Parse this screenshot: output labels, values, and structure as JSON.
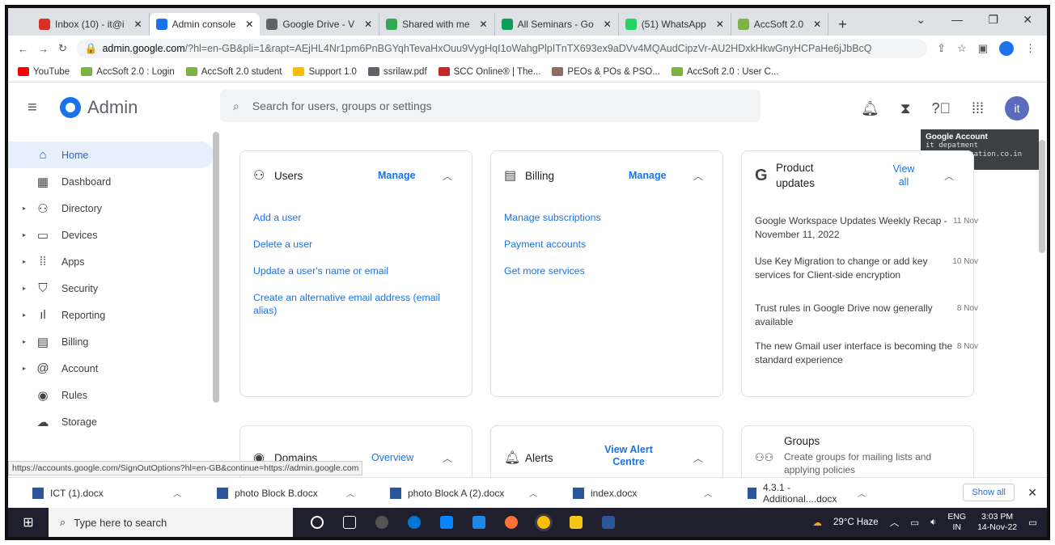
{
  "browser": {
    "tabs": [
      {
        "label": "Inbox (10) - it@i",
        "color": "#d93025"
      },
      {
        "label": "Admin console",
        "color": "#1a73e8"
      },
      {
        "label": "Google Drive - V",
        "color": "#5f6368"
      },
      {
        "label": "Shared with me",
        "color": "#34a853"
      },
      {
        "label": "All Seminars - Go",
        "color": "#0f9d58"
      },
      {
        "label": "(51) WhatsApp",
        "color": "#25d366"
      },
      {
        "label": "AccSoft 2.0",
        "color": "#7cb342"
      }
    ],
    "url_host": "admin.google.com",
    "url_rest": "/?hl=en-GB&pli=1&rapt=AEjHL4Nr1pm6PnBGYqhTevaHxOuu9VygHqI1oWahgPlpITnTX693ex9aDVv4MQAudCipzVr-AU2HDxkHkwGnyHCPaHe6jJbBcQ",
    "bookmarks": [
      {
        "label": "YouTube",
        "color": "#ff0000"
      },
      {
        "label": "AccSoft 2.0 : Login",
        "color": "#7cb342"
      },
      {
        "label": "AccSoft 2.0 student",
        "color": "#7cb342"
      },
      {
        "label": "Support 1.0",
        "color": "#fbbc04"
      },
      {
        "label": "ssrilaw.pdf",
        "color": "#5f6368"
      },
      {
        "label": "SCC Online® | The...",
        "color": "#c62828"
      },
      {
        "label": "PEOs & POs & PSO...",
        "color": "#8d6e63"
      },
      {
        "label": "AccSoft 2.0 : User C...",
        "color": "#7cb342"
      }
    ]
  },
  "header": {
    "app_name": "Admin",
    "search_placeholder": "Search for users, groups or settings",
    "avatar_letter": "it"
  },
  "tooltip": {
    "title": "Google Account",
    "name": "it depatment",
    "email": "it@iconeducation.co.in"
  },
  "sidebar": {
    "items": [
      {
        "label": "Home",
        "icon": "⌂",
        "caret": ""
      },
      {
        "label": "Dashboard",
        "icon": "▦",
        "caret": ""
      },
      {
        "label": "Directory",
        "icon": "⚇",
        "caret": "▸"
      },
      {
        "label": "Devices",
        "icon": "▭",
        "caret": "▸"
      },
      {
        "label": "Apps",
        "icon": "⁞⁞",
        "caret": "▸"
      },
      {
        "label": "Security",
        "icon": "⛉",
        "caret": "▸"
      },
      {
        "label": "Reporting",
        "icon": "ıl",
        "caret": "▸"
      },
      {
        "label": "Billing",
        "icon": "▤",
        "caret": "▸"
      },
      {
        "label": "Account",
        "icon": "@",
        "caret": "▸"
      },
      {
        "label": "Rules",
        "icon": "◉",
        "caret": ""
      },
      {
        "label": "Storage",
        "icon": "☁",
        "caret": ""
      }
    ]
  },
  "cards": {
    "users": {
      "title": "Users",
      "action": "Manage",
      "links": [
        "Add a user",
        "Delete a user",
        "Update a user's name or email",
        "Create an alternative email address (email alias)"
      ]
    },
    "billing": {
      "title": "Billing",
      "action": "Manage",
      "links": [
        "Manage subscriptions",
        "Payment accounts",
        "Get more services"
      ]
    },
    "updates": {
      "title": "Product updates",
      "action": "View all",
      "items": [
        {
          "text": "Google Workspace Updates Weekly Recap - November 11, 2022",
          "date": "11 Nov"
        },
        {
          "text": "Use Key Migration to change or add key services for Client-side encryption",
          "date": "10 Nov"
        },
        {
          "text": "Trust rules in Google Drive now generally available",
          "date": "8 Nov"
        },
        {
          "text": "The new Gmail user interface is becoming the standard experience",
          "date": "8 Nov"
        }
      ]
    },
    "domains": {
      "title": "Domains",
      "action": "Overview"
    },
    "alerts": {
      "title": "Alerts",
      "action": "View Alert Centre"
    },
    "groups": {
      "title": "Groups",
      "desc": "Create groups for mailing lists and applying policies"
    }
  },
  "status_url": "https://accounts.google.com/SignOutOptions?hl=en-GB&continue=https://admin.google.com",
  "downloads": {
    "items": [
      "ICT (1).docx",
      "photo Block B.docx",
      "photo Block A (2).docx",
      "index.docx",
      "4.3.1 - Additional....docx"
    ],
    "show_all": "Show all"
  },
  "taskbar": {
    "search_placeholder": "Type here to search",
    "weather": "29°C Haze",
    "lang": "ENG",
    "region": "IN",
    "time": "3:03 PM",
    "date": "14-Nov-22"
  }
}
